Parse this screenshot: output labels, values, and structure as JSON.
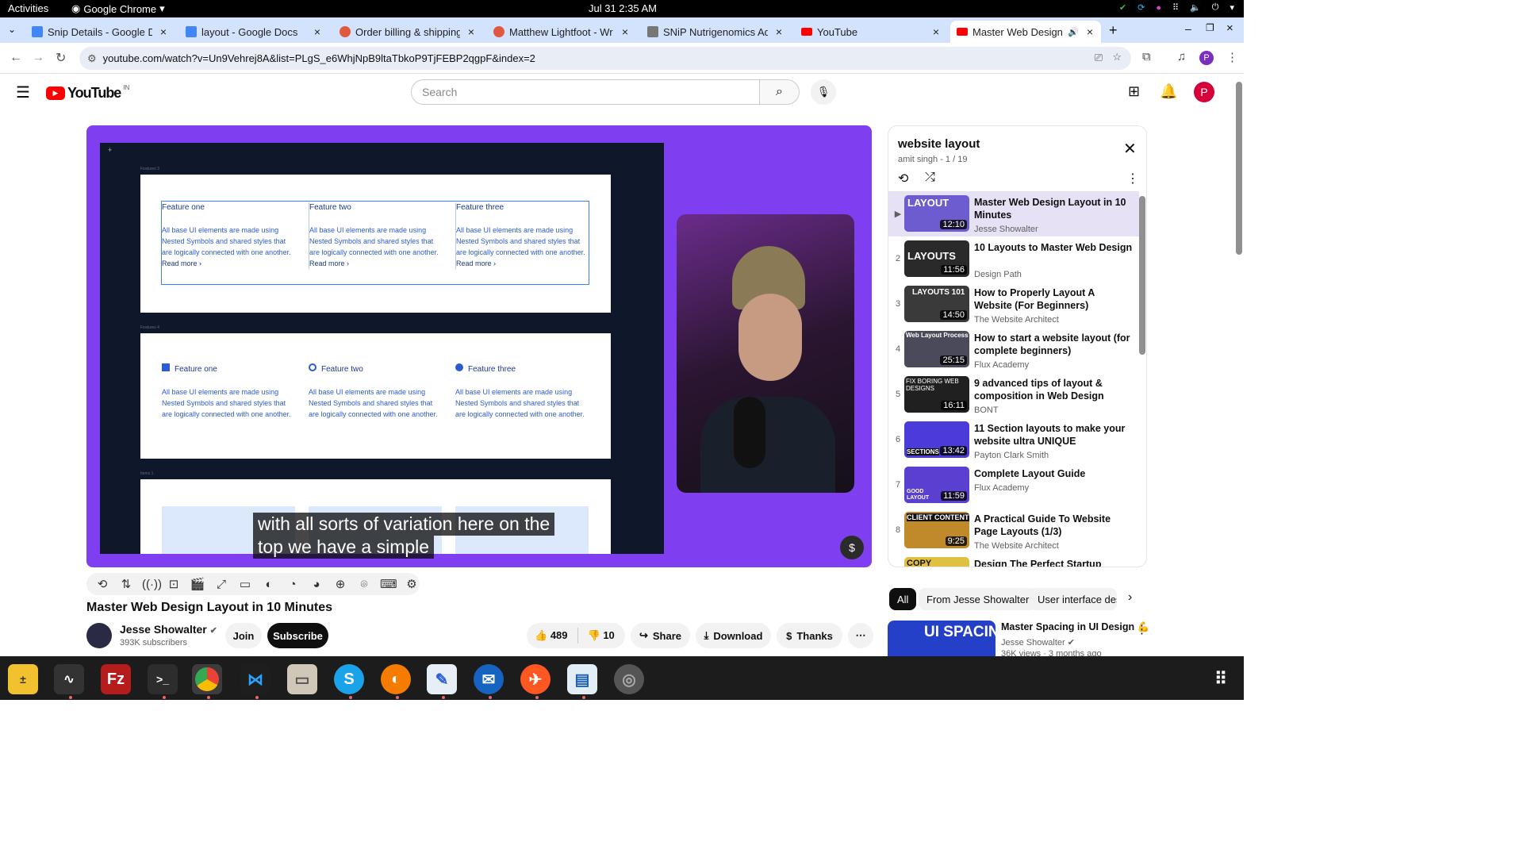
{
  "system": {
    "activities": "Activities",
    "app": "Google Chrome",
    "clock": "Jul 31  2:35 AM"
  },
  "tabs": [
    {
      "label": "Snip Details - Google Do",
      "color": "#4285f4"
    },
    {
      "label": "layout - Google Docs",
      "color": "#4285f4"
    },
    {
      "label": "Order billing & shipping",
      "color": "#e2583e"
    },
    {
      "label": "Matthew Lightfoot - Wr",
      "color": "#e2583e"
    },
    {
      "label": "SNiP Nutrigenomics Adm",
      "color": "#555555"
    },
    {
      "label": "YouTube",
      "color": "#ff0000"
    },
    {
      "label": "Master Web Design L",
      "color": "#ff0000"
    }
  ],
  "url": "youtube.com/watch?v=Un9Vehrej8A&list=PLgS_e6WhjNpB9ltaTbkoP9TjFEBP2qgpF&index=2",
  "yt": {
    "logo": "YouTube",
    "region": "IN",
    "search_placeholder": "Search",
    "avatar": "P"
  },
  "video": {
    "frame_label1": "Features 3",
    "frame_label2": "Features 4",
    "frame_label3": "Items 1",
    "features": [
      {
        "title": "Feature one",
        "body": "All base UI elements are made using Nested Symbols and shared styles that are logically connected with one another.",
        "link": "Read more ›"
      },
      {
        "title": "Feature two",
        "body": "All base UI elements are made using Nested Symbols and shared styles that are logically connected with one another.",
        "link": "Read more ›"
      },
      {
        "title": "Feature three",
        "body": "All base UI elements are made using Nested Symbols and shared styles that are logically connected with one another.",
        "link": "Read more ›"
      }
    ],
    "caption_line1": "with all sorts of variation here on the",
    "caption_line2": "top we have a simple"
  },
  "details": {
    "title": "Master Web Design Layout in 10 Minutes",
    "channel": "Jesse Showalter",
    "subs": "393K subscribers",
    "join": "Join",
    "subscribe": "Subscribe",
    "likes": "489",
    "dislikes": "10",
    "share": "Share",
    "download": "Download",
    "thanks": "Thanks",
    "more": "⋯"
  },
  "playlist": {
    "title": "website layout",
    "meta": "amit singh - 1 / 19",
    "items": [
      {
        "n": "▶",
        "title": "Master Web Design Layout in 10 Minutes",
        "channel": "Jesse Showalter",
        "dur": "12:10",
        "thumb": "LAYOUT",
        "color": "#6d5bd0"
      },
      {
        "n": "2",
        "title": "10 Layouts to Master Web Design",
        "channel": "Design Path",
        "dur": "11:56",
        "thumb": "LAYOUTS",
        "color": "#2a2a2a"
      },
      {
        "n": "3",
        "title": "How to Properly Layout A Website (For Beginners)",
        "channel": "The Website Architect",
        "dur": "14:50",
        "thumb": "LAYOUTS 101",
        "color": "#3a3a3a"
      },
      {
        "n": "4",
        "title": "How to start a website layout (for complete beginners)",
        "channel": "Flux Academy",
        "dur": "25:15",
        "thumb": "Web Layout Process",
        "color": "#4a4a5a"
      },
      {
        "n": "5",
        "title": "9 advanced tips of layout & composition in Web Design",
        "channel": "BONT",
        "dur": "16:11",
        "thumb": "FIX BORING WEB DESIGNS",
        "color": "#202020"
      },
      {
        "n": "6",
        "title": "11 Section layouts to make your website ultra UNIQUE",
        "channel": "Payton Clark Smith",
        "dur": "13:42",
        "thumb": "SECTIONS",
        "color": "#4b3bd8"
      },
      {
        "n": "7",
        "title": "Complete Layout Guide",
        "channel": "Flux Academy",
        "dur": "11:59",
        "thumb": "GOOD LAYOUT",
        "color": "#5a3fd0"
      },
      {
        "n": "8",
        "title": "A Practical Guide To Website Page Layouts (1/3)",
        "channel": "The Website Architect",
        "dur": "9:25",
        "thumb": "CLIENT CONTENT",
        "color": "#c08a2a"
      },
      {
        "n": "",
        "title": "Design The Perfect Startup",
        "channel": "",
        "dur": "",
        "thumb": "COPY",
        "color": "#e0c040"
      }
    ]
  },
  "chips": [
    "All",
    "From Jesse Showalter",
    "User interface desi"
  ],
  "related": {
    "title": "Master Spacing in UI Design 💪",
    "channel": "Jesse Showalter",
    "meta": "36K views · 3 months ago",
    "thumb": "UI SPACING"
  }
}
